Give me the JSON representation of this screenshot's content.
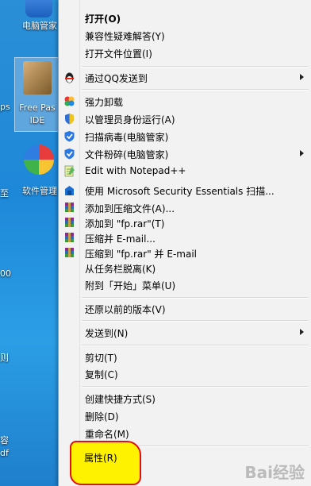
{
  "desktop": {
    "icons": [
      {
        "label": "电脑管家"
      },
      {
        "label_line1": "Free Pas",
        "label_line2": "IDE"
      },
      {
        "label": "软件管理"
      }
    ],
    "edge_texts": [
      "ps",
      "至",
      "00",
      "则",
      "容",
      "df"
    ]
  },
  "context_menu": {
    "items": {
      "open": "打开(O)",
      "compat": "兼容性疑难解答(Y)",
      "open_location": "打开文件位置(I)",
      "qq_send": "通过QQ发送到",
      "force_uninstall": "强力卸载",
      "run_as_admin": "以管理员身份运行(A)",
      "scan_virus": "扫描病毒(电脑管家)",
      "shred": "文件粉碎(电脑管家)",
      "notepad": "Edit with Notepad++",
      "mse_scan": "使用 Microsoft Security Essentials 扫描...",
      "add_archive": "添加到压缩文件(A)...",
      "add_fp_rar": "添加到 \"fp.rar\"(T)",
      "compress_email": "压缩并 E-mail...",
      "compress_fp_email": "压缩到 \"fp.rar\" 并 E-mail",
      "unpin_taskbar": "从任务栏脱离(K)",
      "pin_start": "附到「开始」菜单(U)",
      "restore_versions": "还原以前的版本(V)",
      "send_to": "发送到(N)",
      "cut": "剪切(T)",
      "copy": "复制(C)",
      "create_shortcut": "创建快捷方式(S)",
      "delete": "删除(D)",
      "rename": "重命名(M)",
      "properties": "属性(R)"
    }
  },
  "watermark": "Bai经验",
  "colors": {
    "highlight": "#fff200",
    "highlight_border": "#e01010"
  }
}
